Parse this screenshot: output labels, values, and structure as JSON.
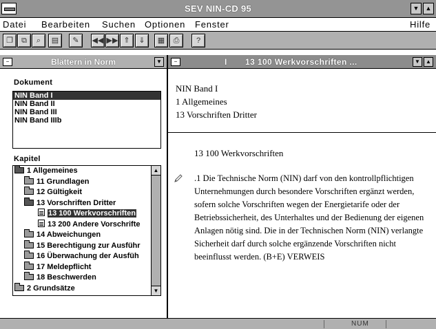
{
  "window": {
    "title": "SEV NIN-CD 95"
  },
  "menu": {
    "datei": "Datei",
    "bearbeiten": "Bearbeiten",
    "suchen": "Suchen",
    "optionen": "Optionen",
    "fenster": "Fenster",
    "hilfe": "Hilfe"
  },
  "toolbar": {
    "buttons": [
      "copy",
      "copy-page",
      "find",
      "print-preview",
      "edit",
      "prev-prev",
      "next-next",
      "up",
      "down",
      "print-doc",
      "print",
      "help"
    ],
    "help_label": "?"
  },
  "left_pane": {
    "title": "Blättern in Norm",
    "dokument_label": "Dokument",
    "documents": [
      "NIN Band I",
      "NIN Band II",
      "NIN Band III",
      "NIN Band IIIb"
    ],
    "kapitel_label": "Kapitel",
    "tree": [
      {
        "label": "1 Allgemeines",
        "level": 0,
        "icon": "open-folder-icon"
      },
      {
        "label": "11 Grundlagen",
        "level": 1,
        "icon": "folder-icon"
      },
      {
        "label": "12 Gültigkeit",
        "level": 1,
        "icon": "folder-icon"
      },
      {
        "label": "13 Vorschriften Dritter",
        "level": 1,
        "icon": "open-folder-icon"
      },
      {
        "label": "13 100 Werkvorschriften",
        "level": 2,
        "icon": "document-icon",
        "selected": true
      },
      {
        "label": "13 200 Andere Vorschrifte",
        "level": 2,
        "icon": "document-icon"
      },
      {
        "label": "14 Abweichungen",
        "level": 1,
        "icon": "folder-icon"
      },
      {
        "label": "15 Berechtigung zur Ausführ",
        "level": 1,
        "icon": "folder-icon"
      },
      {
        "label": "16 Überwachung der Ausfüh",
        "level": 1,
        "icon": "folder-icon"
      },
      {
        "label": "17 Meldepflicht",
        "level": 1,
        "icon": "folder-icon"
      },
      {
        "label": "18 Beschwerden",
        "level": 1,
        "icon": "folder-icon"
      },
      {
        "label": "2 Grundsätze",
        "level": 0,
        "icon": "folder-icon"
      }
    ]
  },
  "right_pane": {
    "title_left": "I",
    "title": "13 100 Werkvorschriften ...",
    "breadcrumb": [
      "NIN Band I",
      "1 Allgemeines",
      "13 Vorschriften Dritter"
    ],
    "heading": "13 100 Werkvorschriften",
    "paragraph": ".1  Die Technische Norm (NIN) darf von den kontrollpflichtigen Unternehmungen durch besondere Vorschriften ergänzt werden, sofern solche Vorschriften wegen der Energietarife oder der Betriebssicherheit, des Unterhaltes und der Bedienung der eigenen Anlagen nötig sind. Die in der Technischen Norm (NIN) verlangte Sicherheit darf durch solche ergänzende Vorschriften nicht beeinflusst werden. (B+E) VERWEIS"
  },
  "status": {
    "num": "NUM"
  }
}
